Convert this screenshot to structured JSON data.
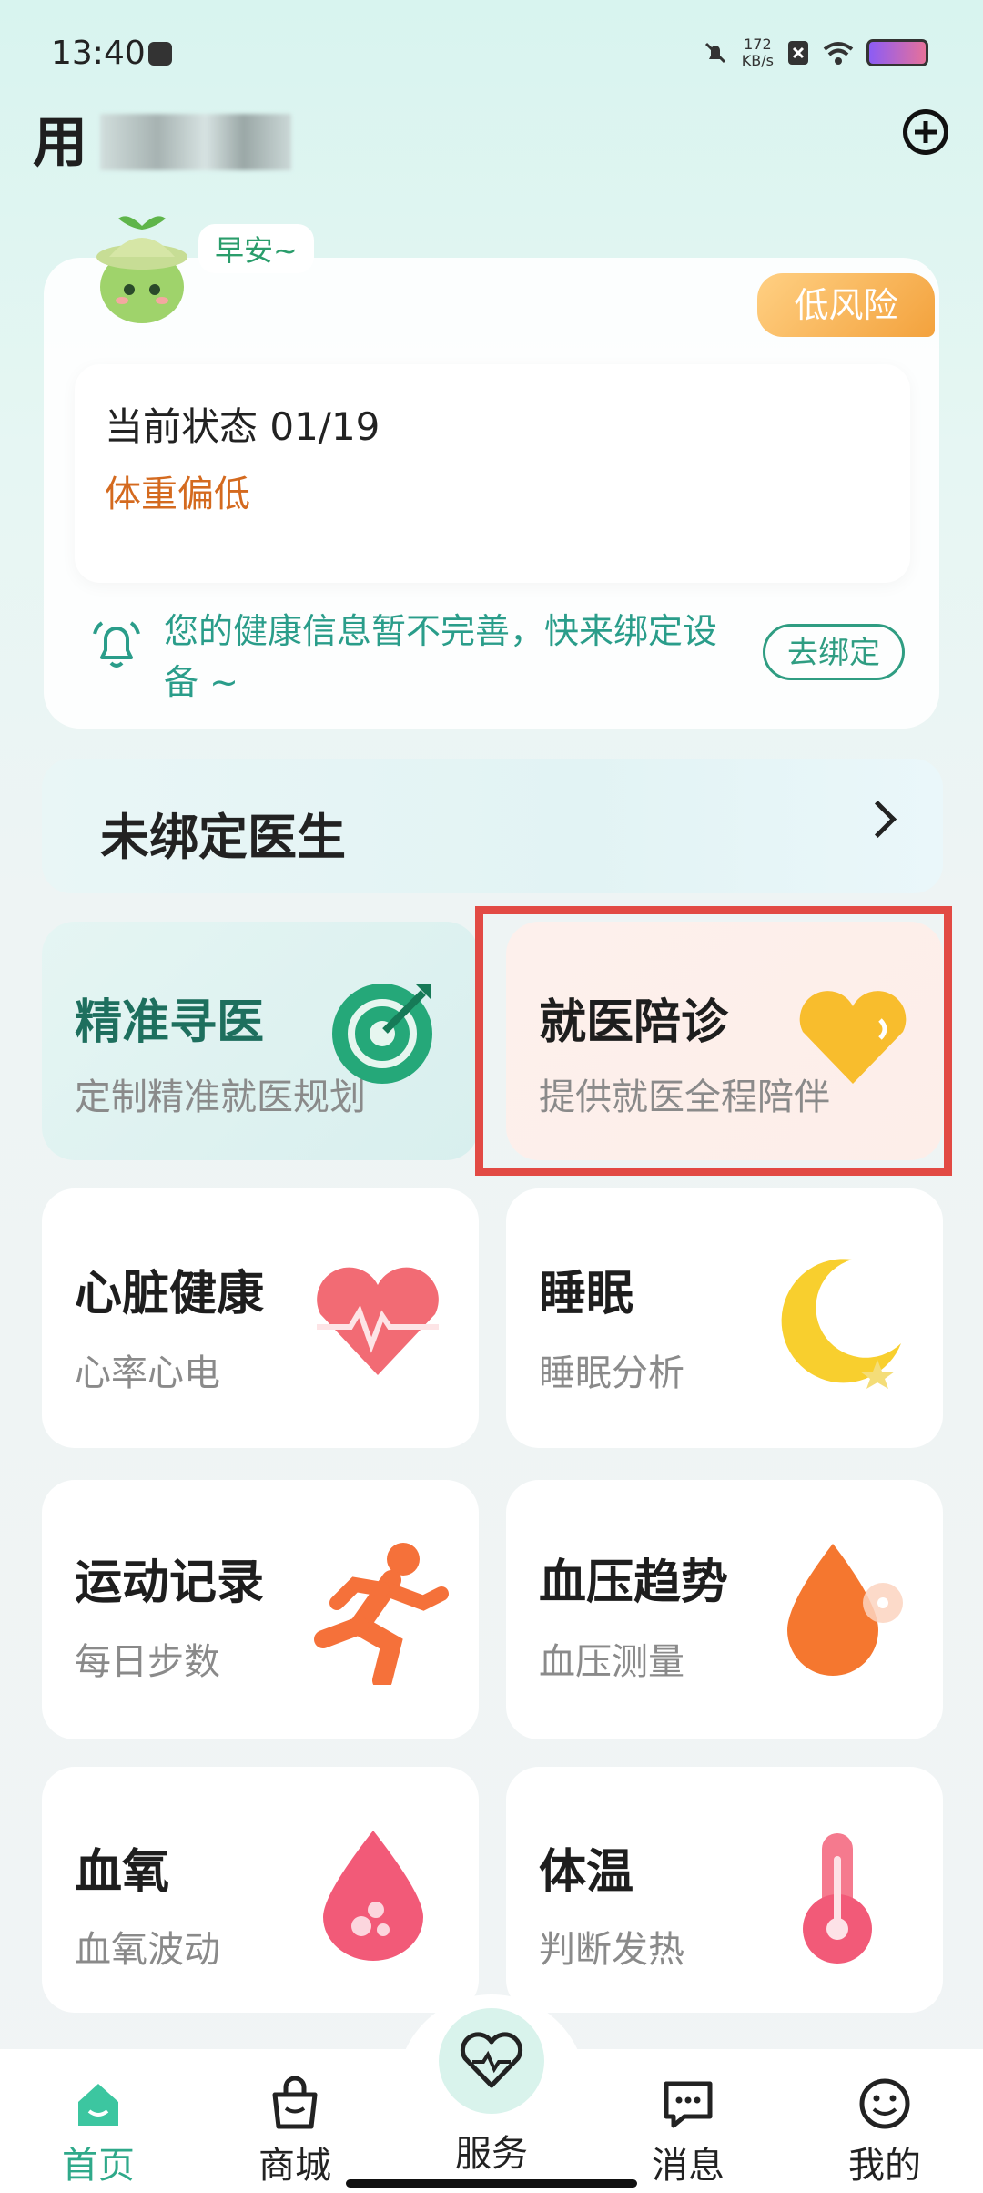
{
  "status_bar": {
    "time": "13:40",
    "net_speed": "172",
    "net_unit": "KB/s"
  },
  "header": {
    "title_visible": "用"
  },
  "status_card": {
    "greeting": "早安~",
    "risk": "低风险",
    "current_status": "当前状态 01/19",
    "weight": "体重偏低",
    "bind_tip": "您的健康信息暂不完善，快来绑定设备 ~",
    "bind_button": "去绑定"
  },
  "doctor": {
    "label": "未绑定医生"
  },
  "tiles": [
    {
      "title": "精准寻医",
      "sub": "定制精准就医规划",
      "icon": "target-icon"
    },
    {
      "title": "就医陪诊",
      "sub": "提供就医全程陪伴",
      "icon": "yellow-heart-icon"
    },
    {
      "title": "心脏健康",
      "sub": "心率心电",
      "icon": "heart-pulse-icon"
    },
    {
      "title": "睡眠",
      "sub": "睡眠分析",
      "icon": "moon-icon"
    },
    {
      "title": "运动记录",
      "sub": "每日步数",
      "icon": "running-person-icon"
    },
    {
      "title": "血压趋势",
      "sub": "血压测量",
      "icon": "blood-drop-icon"
    },
    {
      "title": "血氧",
      "sub": "血氧波动",
      "icon": "oxygen-drop-icon"
    },
    {
      "title": "体温",
      "sub": "判断发热",
      "icon": "thermometer-icon"
    }
  ],
  "nav": [
    {
      "label": "首页",
      "icon": "home-icon"
    },
    {
      "label": "商城",
      "icon": "shopping-bag-icon"
    },
    {
      "label": "服务",
      "icon": "heart-pulse-icon"
    },
    {
      "label": "消息",
      "icon": "message-icon"
    },
    {
      "label": "我的",
      "icon": "smiley-icon"
    }
  ],
  "colors": {
    "accent_green": "#2a9d8a",
    "risk_orange": "#f3a23d",
    "weight_text": "#d46a1f",
    "highlight_red": "#e24a44"
  }
}
